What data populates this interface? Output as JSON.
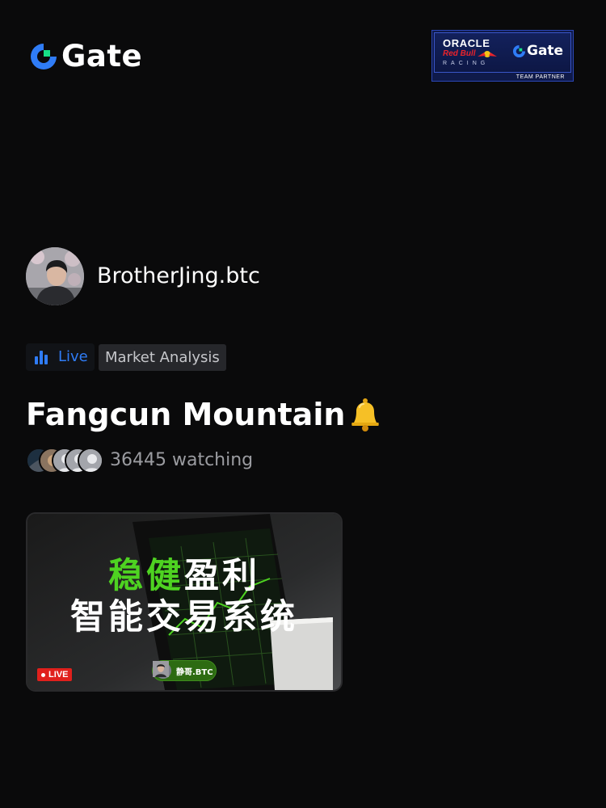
{
  "brand": {
    "name": "Gate",
    "accent": "#2f7cf6",
    "logo_green": "#17e087"
  },
  "partner_badge": {
    "line1": "ORACLE",
    "line2": "Red Bull",
    "line3": "RACING",
    "gate": "Gate",
    "footer": "TEAM PARTNER"
  },
  "host": {
    "name": "BrotherJing.btc",
    "avatar_icon": "user-photo"
  },
  "tags": {
    "live_label": "Live",
    "category": "Market Analysis"
  },
  "stream": {
    "title": "Fangcun Mountain",
    "title_emoji": "bell-icon",
    "watching_text": "36445 watching"
  },
  "thumbnail": {
    "headline_green": "稳健",
    "headline_white": "盈利",
    "subline": "智能交易系统",
    "live_badge": "LIVE",
    "host_chip": "静哥.BTC",
    "green": "#4ed321"
  }
}
